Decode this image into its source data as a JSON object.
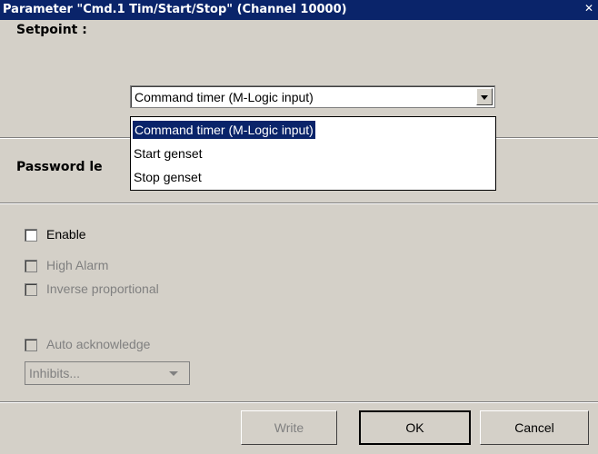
{
  "window": {
    "title": "Parameter \"Cmd.1 Tim/Start/Stop\" (Channel 10000)",
    "close_glyph": "✕"
  },
  "setpoint": {
    "label": "Setpoint :",
    "selected_value": "Command timer (M-Logic input)",
    "options": [
      "Command timer (M-Logic input)",
      "Start genset",
      "Stop genset"
    ]
  },
  "password": {
    "label": "Password le"
  },
  "checkboxes": {
    "enable": "Enable",
    "high_alarm": "High Alarm",
    "inverse_proportional": "Inverse proportional",
    "auto_acknowledge": "Auto acknowledge"
  },
  "inhibits": {
    "value": "Inhibits..."
  },
  "buttons": {
    "write": "Write",
    "ok": "OK",
    "cancel": "Cancel"
  },
  "colors": {
    "titlebar": "#0a246a",
    "face": "#d4d0c8",
    "selection": "#0a246a"
  }
}
